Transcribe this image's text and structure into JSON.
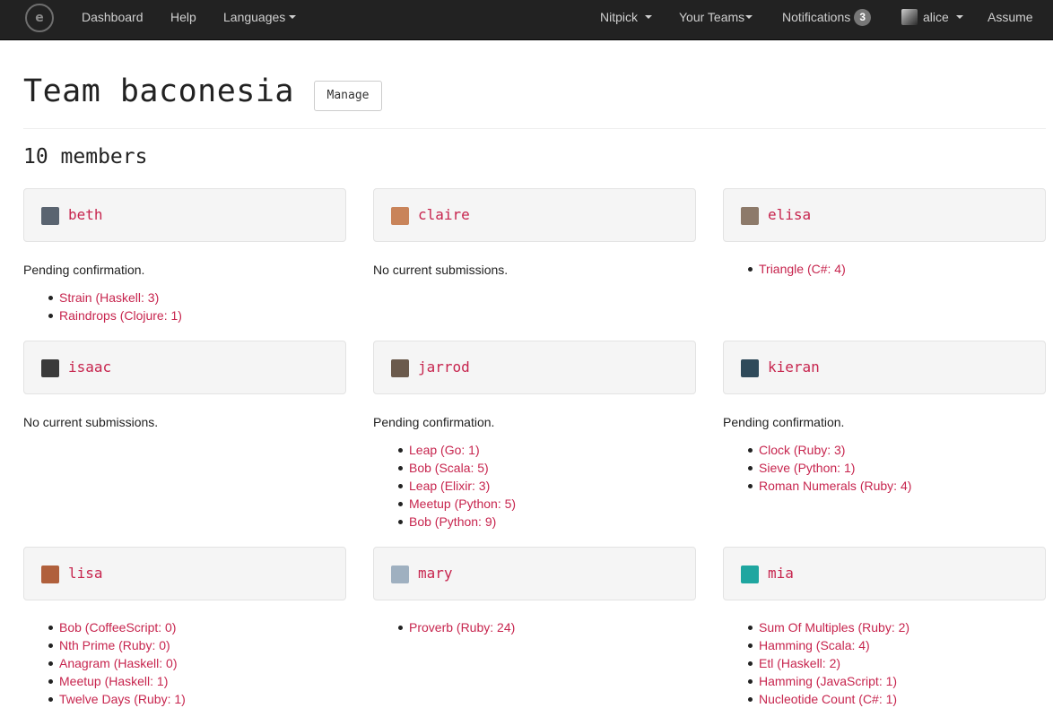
{
  "navbar": {
    "logo_glyph": "e",
    "dashboard": "Dashboard",
    "help": "Help",
    "languages": "Languages",
    "nitpick": "Nitpick",
    "your_teams": "Your Teams",
    "notifications": "Notifications",
    "notifications_count": "3",
    "user": "alice",
    "assume": "Assume"
  },
  "header": {
    "title": "Team baconesia",
    "manage": "Manage",
    "members_count": "10 members"
  },
  "members": [
    {
      "name": "beth",
      "status": "Pending confirmation.",
      "avatar_color": "#5a6470",
      "submissions": [
        "Strain (Haskell: 3)",
        "Raindrops (Clojure: 1)"
      ]
    },
    {
      "name": "claire",
      "status": "No current submissions.",
      "avatar_color": "#c9845a",
      "submissions": []
    },
    {
      "name": "elisa",
      "status": "",
      "avatar_color": "#8d7a6a",
      "submissions": [
        "Triangle (C#: 4)"
      ]
    },
    {
      "name": "isaac",
      "status": "No current submissions.",
      "avatar_color": "#3a3a3a",
      "submissions": []
    },
    {
      "name": "jarrod",
      "status": "Pending confirmation.",
      "avatar_color": "#6b5a4c",
      "submissions": [
        "Leap (Go: 1)",
        "Bob (Scala: 5)",
        "Leap (Elixir: 3)",
        "Meetup (Python: 5)",
        "Bob (Python: 9)"
      ]
    },
    {
      "name": "kieran",
      "status": "Pending confirmation.",
      "avatar_color": "#2f4a5a",
      "submissions": [
        "Clock (Ruby: 3)",
        "Sieve (Python: 1)",
        "Roman Numerals (Ruby: 4)"
      ]
    },
    {
      "name": "lisa",
      "status": "",
      "avatar_color": "#b0603c",
      "submissions": [
        "Bob (CoffeeScript: 0)",
        "Nth Prime (Ruby: 0)",
        "Anagram (Haskell: 0)",
        "Meetup (Haskell: 1)",
        "Twelve Days (Ruby: 1)"
      ]
    },
    {
      "name": "mary",
      "status": "",
      "avatar_color": "#9fb0c0",
      "submissions": [
        "Proverb (Ruby: 24)"
      ]
    },
    {
      "name": "mia",
      "status": "",
      "avatar_color": "#1fa6a0",
      "submissions": [
        "Sum Of Multiples (Ruby: 2)",
        "Hamming (Scala: 4)",
        "Etl (Haskell: 2)",
        "Hamming (JavaScript: 1)",
        "Nucleotide Count (C#: 1)"
      ]
    }
  ]
}
